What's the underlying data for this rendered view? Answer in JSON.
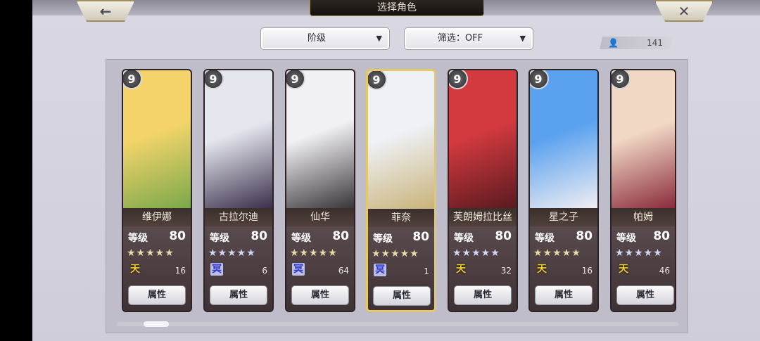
{
  "header": {
    "title": "选择角色",
    "back_icon": "←",
    "close_icon": "✕"
  },
  "controls": {
    "rank_label": "阶级",
    "filter_label": "筛选：OFF",
    "dropdown_arrow": "▼",
    "owned_count": "141",
    "person_icon": "👤"
  },
  "cards": [
    {
      "name": "维伊娜",
      "badge": "9",
      "level_label": "等级",
      "level": "80",
      "stars": "★★★★★",
      "star_color": "gold",
      "element": "天",
      "element_type": "sky",
      "number": "16",
      "button": "属性",
      "selected": false,
      "art_colors": [
        "#f4d46a",
        "#7aa84a"
      ]
    },
    {
      "name": "古拉尔迪",
      "badge": "9",
      "level_label": "等级",
      "level": "80",
      "stars": "★★★★★",
      "star_color": "blue",
      "element": "冥",
      "element_type": "dark",
      "number": "6",
      "button": "属性",
      "selected": false,
      "art_colors": [
        "#e4e6ee",
        "#3b2f4a"
      ]
    },
    {
      "name": "仙华",
      "badge": "9",
      "level_label": "等级",
      "level": "80",
      "stars": "★★★★★",
      "star_color": "gold",
      "element": "冥",
      "element_type": "dark",
      "number": "64",
      "button": "属性",
      "selected": false,
      "art_colors": [
        "#f1f0f2",
        "#39363a"
      ]
    },
    {
      "name": "菲奈",
      "badge": "9",
      "level_label": "等级",
      "level": "80",
      "stars": "★★★★★",
      "star_color": "gold",
      "element": "冥",
      "element_type": "dark",
      "number": "1",
      "button": "属性",
      "selected": true,
      "art_colors": [
        "#eef1f6",
        "#c9b37a"
      ]
    },
    {
      "name": "芙朗姆拉比丝",
      "badge": "9",
      "level_label": "等级",
      "level": "80",
      "stars": "★★★★★",
      "star_color": "blue",
      "element": "天",
      "element_type": "sky",
      "number": "32",
      "button": "属性",
      "selected": false,
      "art_colors": [
        "#d33a3f",
        "#5a1a1f"
      ]
    },
    {
      "name": "星之子",
      "badge": "9",
      "level_label": "等级",
      "level": "80",
      "stars": "★★★★★",
      "star_color": "gold",
      "element": "天",
      "element_type": "sky",
      "number": "16",
      "button": "属性",
      "selected": false,
      "art_colors": [
        "#5aa1ef",
        "#f0eef2"
      ]
    },
    {
      "name": "帕姆",
      "badge": "9",
      "level_label": "等级",
      "level": "80",
      "stars": "★★★★★",
      "star_color": "blue",
      "element": "天",
      "element_type": "sky",
      "number": "46",
      "button": "属性",
      "selected": false,
      "art_colors": [
        "#f1d8c4",
        "#8a2b3c"
      ]
    }
  ]
}
